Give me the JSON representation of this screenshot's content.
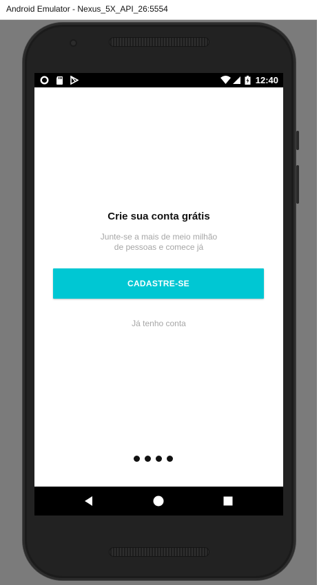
{
  "window": {
    "title": "Android Emulator - Nexus_5X_API_26:5554"
  },
  "statusbar": {
    "left_icons": [
      "record-icon",
      "sd-card-icon",
      "play-store-icon"
    ],
    "right_icons": [
      "wifi-icon",
      "signal-icon",
      "battery-icon"
    ],
    "time": "12:40"
  },
  "content": {
    "title": "Crie sua conta grátis",
    "subtitle_line1": "Junte-se a mais de meio milhão",
    "subtitle_line2": "de pessoas  e comece já",
    "cta_label": "CADASTRE-SE",
    "login_label": "Já tenho conta"
  },
  "pager": {
    "page_count": 4
  },
  "navbar": {
    "buttons": [
      "back-icon",
      "home-icon",
      "recents-icon"
    ]
  },
  "colors": {
    "accent": "#00c7d3",
    "muted_text": "#a6a6a6",
    "title_text": "#111111"
  }
}
